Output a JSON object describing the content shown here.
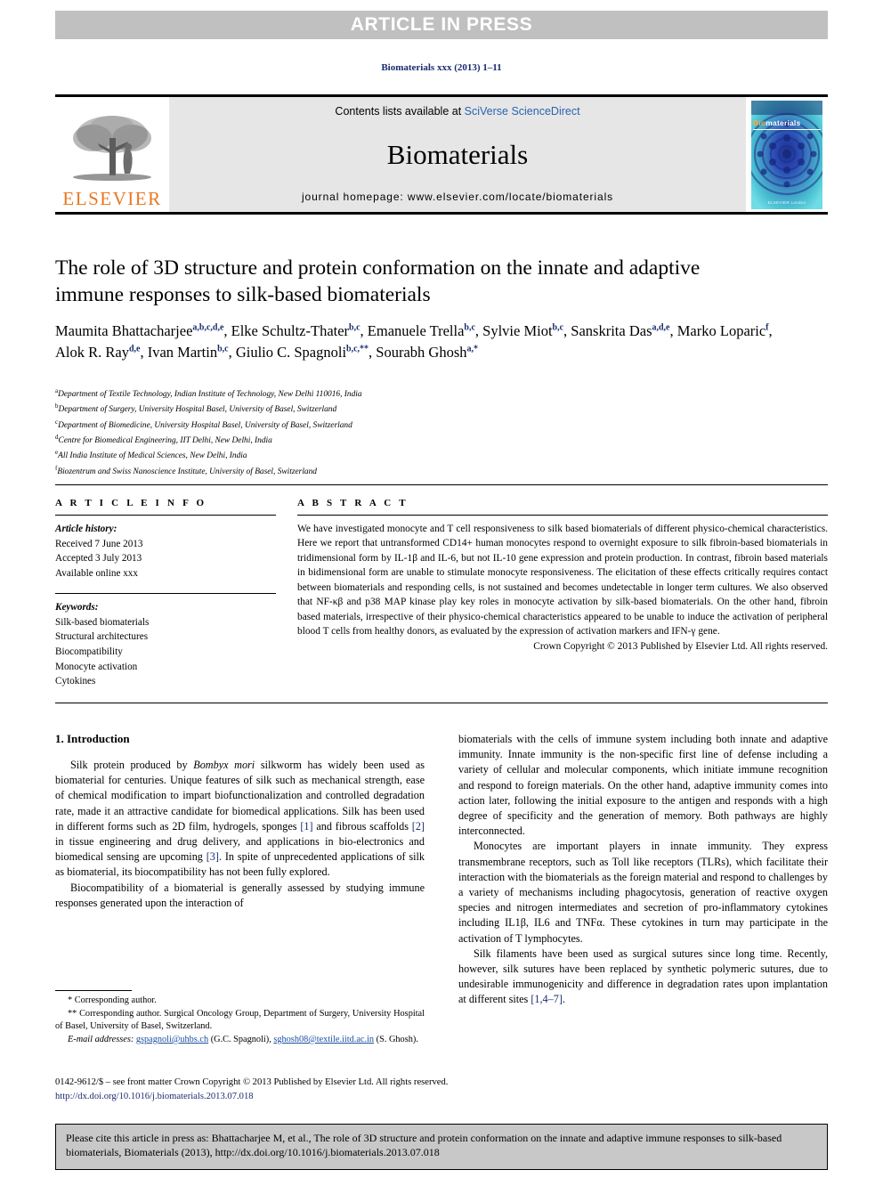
{
  "banner": {
    "label": "ARTICLE IN PRESS"
  },
  "running_head": "Biomaterials xxx (2013) 1–11",
  "masthead": {
    "contents_prefix": "Contents lists available at ",
    "contents_link": "SciVerse ScienceDirect",
    "journal_name": "Biomaterials",
    "homepage": "journal homepage: www.elsevier.com/locate/biomaterials",
    "publisher_logo_text": "ELSEVIER",
    "publisher_logo_icon": "elsevier-tree-icon",
    "cover_label_b": "Bio",
    "cover_label_rest": "materials",
    "cover_bottom": "ELSEVIER London"
  },
  "article": {
    "title": "The role of 3D structure and protein conformation on the innate and adaptive immune responses to silk-based biomaterials",
    "authors": [
      {
        "name": "Maumita Bhattacharjee",
        "sup": "a,b,c,d,e"
      },
      {
        "name": "Elke Schultz-Thater",
        "sup": "b,c"
      },
      {
        "name": "Emanuele Trella",
        "sup": "b,c"
      },
      {
        "name": "Sylvie Miot",
        "sup": "b,c"
      },
      {
        "name": "Sanskrita Das",
        "sup": "a,d,e"
      },
      {
        "name": "Marko Loparic",
        "sup": "f"
      },
      {
        "name": "Alok R. Ray",
        "sup": "d,e"
      },
      {
        "name": "Ivan Martin",
        "sup": "b,c"
      },
      {
        "name": "Giulio C. Spagnoli",
        "sup": "b,c,**"
      },
      {
        "name": "Sourabh Ghosh",
        "sup": "a,*"
      }
    ],
    "affiliations": [
      {
        "mark": "a",
        "text": "Department of Textile Technology, Indian Institute of Technology, New Delhi 110016, India"
      },
      {
        "mark": "b",
        "text": "Department of Surgery, University Hospital Basel, University of Basel, Switzerland"
      },
      {
        "mark": "c",
        "text": "Department of Biomedicine, University Hospital Basel, University of Basel, Switzerland"
      },
      {
        "mark": "d",
        "text": "Centre for Biomedical Engineering, IIT Delhi, New Delhi, India"
      },
      {
        "mark": "e",
        "text": "All India Institute of Medical Sciences, New Delhi, India"
      },
      {
        "mark": "f",
        "text": "Biozentrum and Swiss Nanoscience Institute, University of Basel, Switzerland"
      }
    ]
  },
  "article_info": {
    "heading": "A R T I C L E  I N F O",
    "history_label": "Article history:",
    "history": [
      "Received 7 June 2013",
      "Accepted 3 July 2013",
      "Available online xxx"
    ],
    "keywords_label": "Keywords:",
    "keywords": [
      "Silk-based biomaterials",
      "Structural architectures",
      "Biocompatibility",
      "Monocyte activation",
      "Cytokines"
    ]
  },
  "abstract": {
    "heading": "A B S T R A C T",
    "text": "We have investigated monocyte and T cell responsiveness to silk based biomaterials of different physico-chemical characteristics. Here we report that untransformed CD14+ human monocytes respond to overnight exposure to silk fibroin-based biomaterials in tridimensional form by IL-1β and IL-6, but not IL-10 gene expression and protein production. In contrast, fibroin based materials in bidimensional form are unable to stimulate monocyte responsiveness. The elicitation of these effects critically requires contact between biomaterials and responding cells, is not sustained and becomes undetectable in longer term cultures. We also observed that NF-κβ and p38 MAP kinase play key roles in monocyte activation by silk-based biomaterials. On the other hand, fibroin based materials, irrespective of their physico-chemical characteristics appeared to be unable to induce the activation of peripheral blood T cells from healthy donors, as evaluated by the expression of activation markers and IFN-γ gene.",
    "copyright": "Crown Copyright © 2013 Published by Elsevier Ltd. All rights reserved."
  },
  "body": {
    "section_heading": "1. Introduction",
    "left_paragraphs": [
      "Silk protein produced by Bombyx mori silkworm has widely been used as biomaterial for centuries. Unique features of silk such as mechanical strength, ease of chemical modification to impart biofunctionalization and controlled degradation rate, made it an attractive candidate for biomedical applications. Silk has been used in different forms such as 2D film, hydrogels, sponges [1] and fibrous scaffolds [2] in tissue engineering and drug delivery, and applications in bio-electronics and biomedical sensing are upcoming [3]. In spite of unprecedented applications of silk as biomaterial, its biocompatibility has not been fully explored.",
      "Biocompatibility of a biomaterial is generally assessed by studying immune responses generated upon the interaction of"
    ],
    "right_paragraphs": [
      "biomaterials with the cells of immune system including both innate and adaptive immunity. Innate immunity is the non-specific first line of defense including a variety of cellular and molecular components, which initiate immune recognition and respond to foreign materials. On the other hand, adaptive immunity comes into action later, following the initial exposure to the antigen and responds with a high degree of specificity and the generation of memory. Both pathways are highly interconnected.",
      "Monocytes are important players in innate immunity. They express transmembrane receptors, such as Toll like receptors (TLRs), which facilitate their interaction with the biomaterials as the foreign material and respond to challenges by a variety of mechanisms including phagocytosis, generation of reactive oxygen species and nitrogen intermediates and secretion of pro-inflammatory cytokines including IL1β, IL6 and TNFα. These cytokines in turn may participate in the activation of T lymphocytes.",
      "Silk filaments have been used as surgical sutures since long time. Recently, however, silk sutures have been replaced by synthetic polymeric sutures, due to undesirable immunogenicity and difference in degradation rates upon implantation at different sites [1,4–7]."
    ]
  },
  "footnotes": {
    "line1": "* Corresponding author.",
    "line2": "** Corresponding author. Surgical Oncology Group, Department of Surgery, University Hospital of Basel, University of Basel, Switzerland.",
    "email_label": "E-mail addresses:",
    "email1": "gspagnoli@uhbs.ch",
    "email1_owner": "(G.C. Spagnoli),",
    "email2": "sghosh08@textile.iitd.ac.in",
    "email2_owner": "(S. Ghosh)."
  },
  "issn": {
    "line": "0142-9612/$ – see front matter Crown Copyright © 2013 Published by Elsevier Ltd. All rights reserved.",
    "doi": "http://dx.doi.org/10.1016/j.biomaterials.2013.07.018"
  },
  "cite_box": {
    "text": "Please cite this article in press as: Bhattacharjee M, et al., The role of 3D structure and protein conformation on the innate and adaptive immune responses to silk-based biomaterials, Biomaterials (2013), http://dx.doi.org/10.1016/j.biomaterials.2013.07.018"
  },
  "colors": {
    "banner_bg": "#c0c0c0",
    "masthead_bg": "#e6e6e6",
    "elsevier_orange": "#E87722",
    "link_blue": "#2b63b0",
    "ref_navy": "#1a2b6d",
    "cite_bg": "#c8c8c8"
  }
}
